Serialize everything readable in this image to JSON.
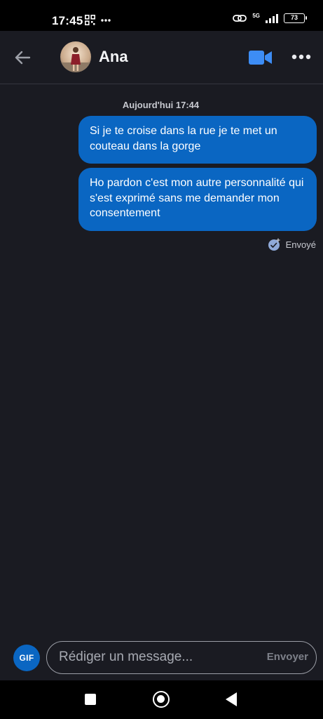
{
  "status_bar": {
    "time": "17:45",
    "network": "5G",
    "battery": "73",
    "icons": [
      "qr-icon",
      "more-dots-icon",
      "link-icon",
      "signal-icon",
      "battery-icon"
    ]
  },
  "header": {
    "contact_name": "Ana",
    "icons": [
      "back-arrow-icon",
      "avatar",
      "video-camera-icon",
      "more-horizontal-icon"
    ]
  },
  "conversation": {
    "date_separator": "Aujourd'hui 17:44",
    "messages": [
      {
        "text": "Si je te croise dans la rue je te met un couteau dans la gorge",
        "direction": "sent"
      },
      {
        "text": "Ho pardon c'est mon autre personnalité qui s'est exprimé sans me demander mon consentement",
        "direction": "sent"
      }
    ],
    "status": "Envoyé"
  },
  "composer": {
    "gif_label": "GIF",
    "placeholder": "Rédiger un message...",
    "send_label": "Envoyer"
  },
  "colors": {
    "background": "#1a1b22",
    "bubble": "#0a66c2",
    "accent_blue": "#0a66c2",
    "video_icon": "#3d8df5"
  }
}
